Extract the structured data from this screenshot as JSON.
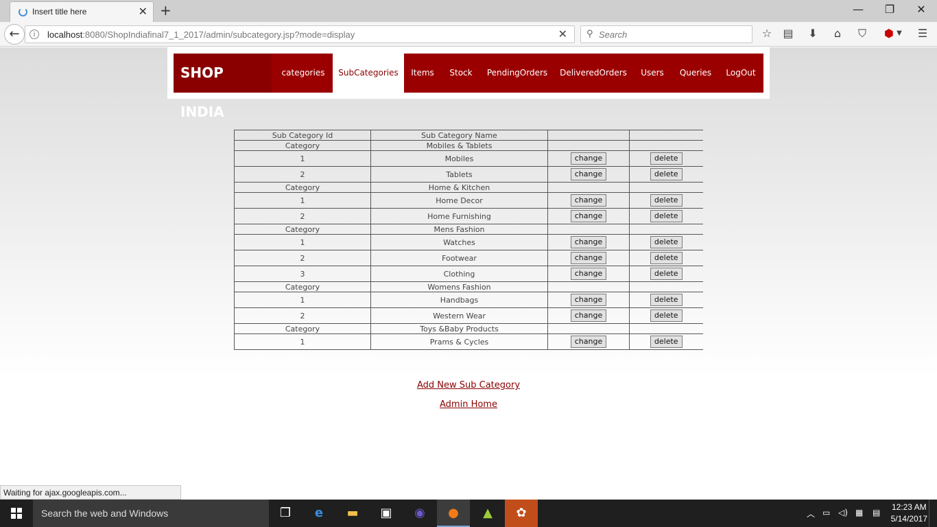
{
  "browser": {
    "tab_title": "Insert title here",
    "url_host": "localhost",
    "url_rest": ":8080/ShopIndiafinal7_1_2017/admin/subcategory.jsp?mode=display",
    "search_placeholder": "Search",
    "status_text": "Waiting for ajax.googleapis.com..."
  },
  "site": {
    "brand": "SHOP INDIA",
    "menu": [
      "categories",
      "SubCategories",
      "Items",
      "Stock",
      "PendingOrders",
      "DeliveredOrders",
      "Users",
      "Queries",
      "LogOut"
    ],
    "active_menu": "SubCategories"
  },
  "table": {
    "headers": [
      "Sub Category Id",
      "Sub Category Name",
      "",
      ""
    ],
    "category_label": "Category",
    "change_label": "change",
    "delete_label": "delete",
    "groups": [
      {
        "category": "Mobiles & Tablets",
        "items": [
          {
            "id": "1",
            "name": "Mobiles"
          },
          {
            "id": "2",
            "name": "Tablets"
          }
        ]
      },
      {
        "category": "Home & Kitchen",
        "items": [
          {
            "id": "1",
            "name": "Home Decor"
          },
          {
            "id": "2",
            "name": "Home Furnishing"
          }
        ]
      },
      {
        "category": "Mens Fashion",
        "items": [
          {
            "id": "1",
            "name": "Watches"
          },
          {
            "id": "2",
            "name": "Footwear"
          },
          {
            "id": "3",
            "name": "Clothing"
          }
        ]
      },
      {
        "category": "Womens Fashion",
        "items": [
          {
            "id": "1",
            "name": "Handbags"
          },
          {
            "id": "2",
            "name": "Western Wear"
          }
        ]
      },
      {
        "category": "Toys &Baby Products",
        "items": [
          {
            "id": "1",
            "name": "Prams & Cycles"
          }
        ]
      }
    ]
  },
  "links": {
    "add_new": "Add New Sub Category",
    "admin_home": "Admin Home"
  },
  "taskbar": {
    "search_placeholder": "Search the web and Windows",
    "time": "12:23 AM",
    "date": "5/14/2017"
  },
  "colors": {
    "brand_red": "#9b0000",
    "link_red": "#8a0000"
  }
}
